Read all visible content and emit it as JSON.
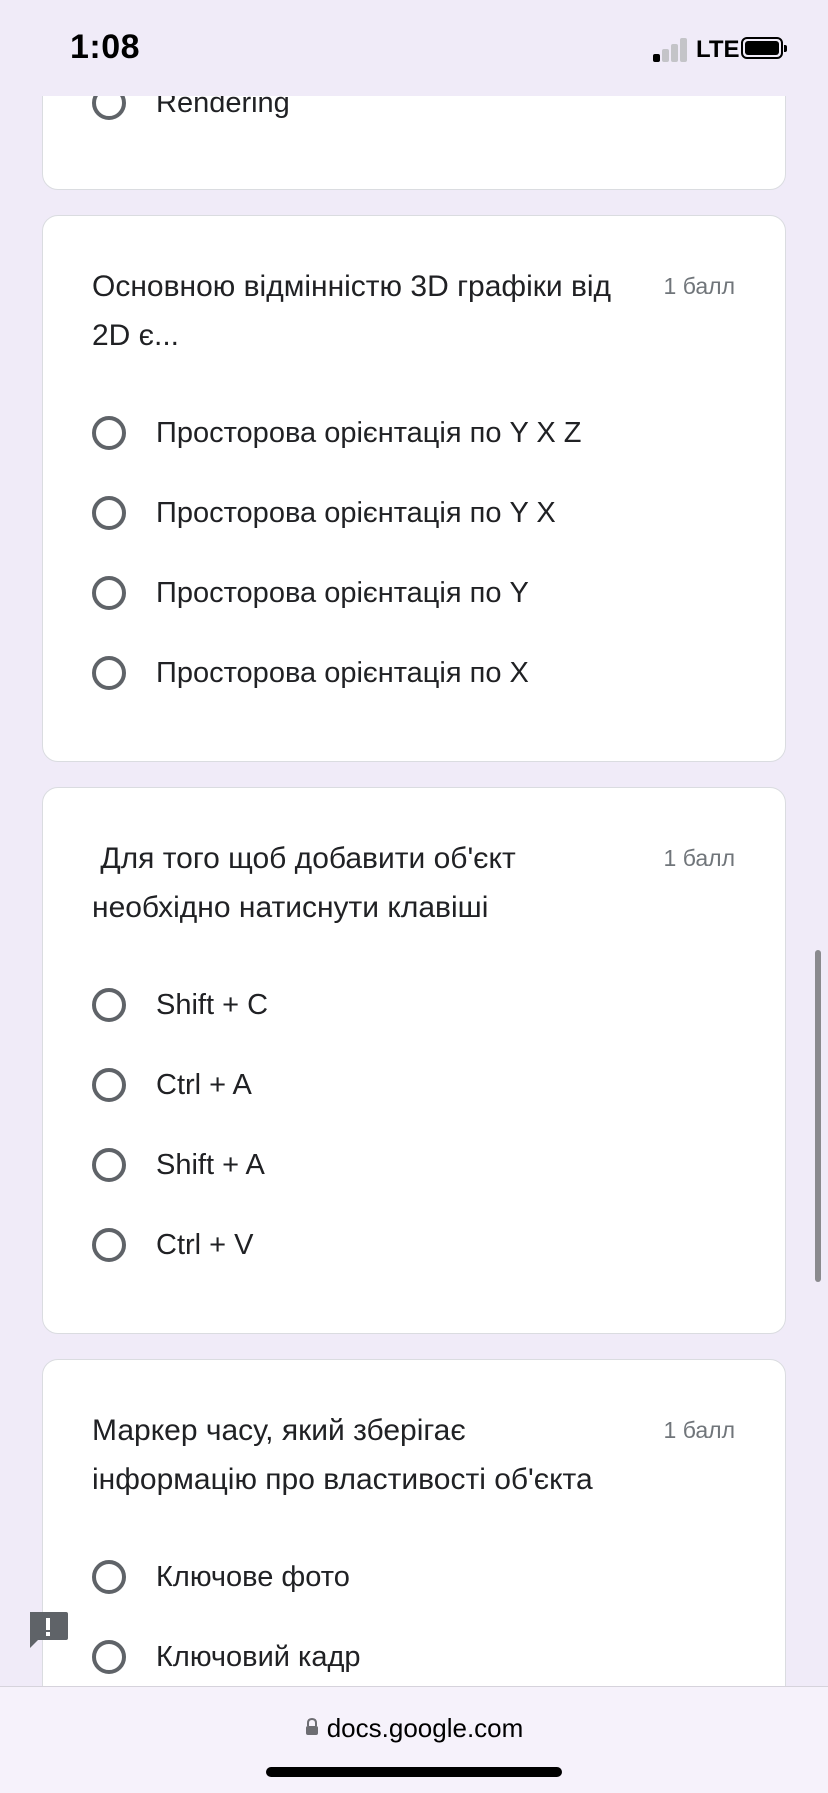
{
  "status_bar": {
    "time": "1:08",
    "network": "LTE"
  },
  "questions": [
    {
      "options": [
        "Rendering"
      ]
    },
    {
      "title": "Основною відмінністю 3D графіки від 2D є...",
      "points": "1 балл",
      "options": [
        "Просторова орієнтація по Y X Z",
        "Просторова орієнтація по Y X",
        "Просторова орієнтація по Y",
        "Просторова орієнтація по X"
      ]
    },
    {
      "title": " Для того щоб добавити об'єкт необхідно натиснути клавіші",
      "points": "1 балл",
      "options": [
        "Shift + C",
        "Ctrl + A",
        "Shift + A",
        "Ctrl + V"
      ]
    },
    {
      "title": "Маркер часу, який зберігає інформацію про властивості об'єкта",
      "points": "1 балл",
      "options": [
        "Ключове фото",
        "Ключовий кадр"
      ]
    }
  ],
  "browser": {
    "url": "docs.google.com"
  },
  "icons": {
    "lock": "lock-icon",
    "feedback": "feedback-icon"
  },
  "colors": {
    "background": "#f0ebf8",
    "card": "#ffffff",
    "radio_border": "#5f6368"
  }
}
